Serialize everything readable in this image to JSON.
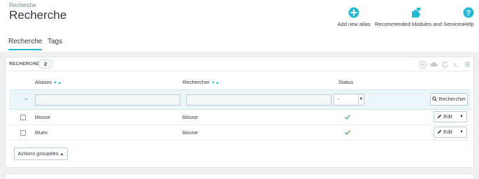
{
  "header": {
    "breadcrumb": "Recherche",
    "title": "Recherche",
    "toolbar": [
      {
        "label": "Add new alias",
        "icon": "add-icon"
      },
      {
        "label": "Recommended Modules and Services",
        "icon": "puzzle-icon"
      },
      {
        "label": "Help",
        "icon": "help-icon"
      }
    ]
  },
  "tabs": [
    {
      "label": "Recherche",
      "active": true
    },
    {
      "label": "Tags",
      "active": false
    }
  ],
  "panel": {
    "title": "Recherche",
    "count": "2",
    "columns": {
      "aliases": "Aliases",
      "search": "Rechercher",
      "status": "Status"
    },
    "filter": {
      "dash": "--",
      "status_value": "-",
      "search_button": "Rechercher"
    },
    "rows": [
      {
        "alias": "bloose",
        "search": "blouse",
        "status": "enabled",
        "edit": "Edit"
      },
      {
        "alias": "blues",
        "search": "blouse",
        "status": "enabled",
        "edit": "Edit"
      }
    ],
    "bulk_actions": "Actions groupées"
  },
  "colors": {
    "accent": "#25b9d7",
    "success": "#70b580"
  }
}
